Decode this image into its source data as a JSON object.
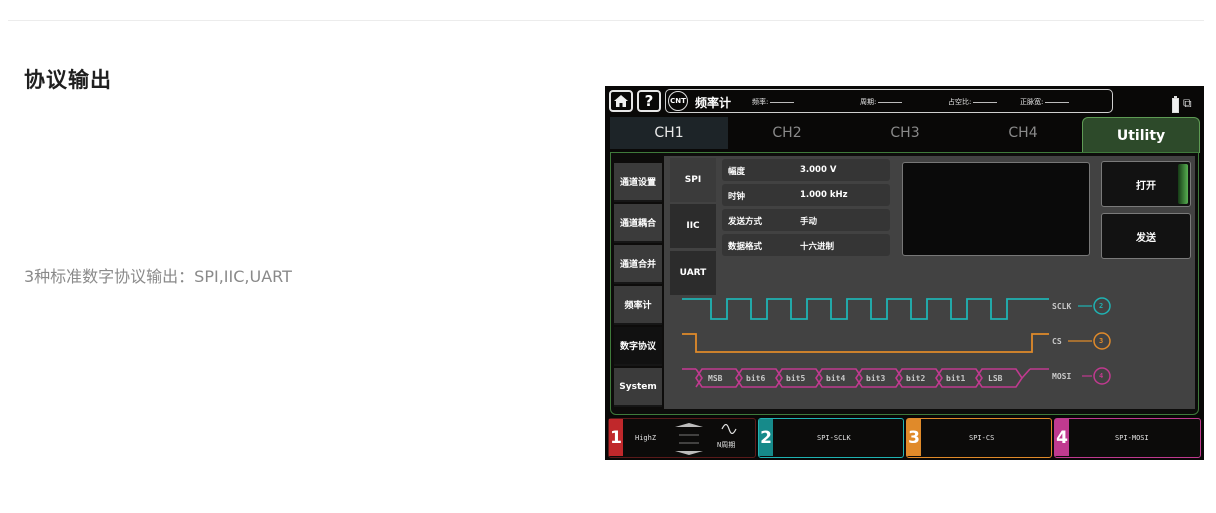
{
  "page": {
    "title": "协议输出",
    "description": "3种标准数字协议输出：SPI,IIC,UART"
  },
  "device": {
    "status": {
      "home_icon": "home-icon",
      "help_label": "?",
      "cnt_badge": "CNT",
      "mode_title": "频率计",
      "freq_label": "频率:",
      "period_label": "周期:",
      "duty_label": "占空比:",
      "pos_width_label": "正脉宽:"
    },
    "tabs": [
      "CH1",
      "CH2",
      "CH3",
      "CH4",
      "Utility"
    ],
    "side_menu": [
      "通道设置",
      "通道耦合",
      "通道合并",
      "频率计",
      "数字协议",
      "System"
    ],
    "protocols": [
      "SPI",
      "IIC",
      "UART"
    ],
    "params": [
      {
        "key": "幅度",
        "value": "3.000 V"
      },
      {
        "key": "时钟",
        "value": "1.000 kHz"
      },
      {
        "key": "发送方式",
        "value": "手动"
      },
      {
        "key": "数据格式",
        "value": "十六进制"
      }
    ],
    "buttons": {
      "open": "打开",
      "send": "发送"
    },
    "signals": [
      {
        "name": "SCLK",
        "channel": "2",
        "color": "#1fb3b3"
      },
      {
        "name": "CS",
        "channel": "3",
        "color": "#e08a2a"
      },
      {
        "name": "MOSI",
        "channel": "4",
        "color": "#c03a8f"
      }
    ],
    "bits": [
      "MSB",
      "bit6",
      "bit5",
      "bit4",
      "bit3",
      "bit2",
      "bit1",
      "LSB"
    ],
    "bottom": [
      {
        "num": "1",
        "text": "HighZ",
        "mode": "N周期",
        "color": "#c0282b"
      },
      {
        "num": "2",
        "text": "SPI-SCLK",
        "color": "#1fb3b3"
      },
      {
        "num": "3",
        "text": "SPI-CS",
        "color": "#e08a2a"
      },
      {
        "num": "4",
        "text": "SPI-MOSI",
        "color": "#c03a8f"
      }
    ]
  }
}
